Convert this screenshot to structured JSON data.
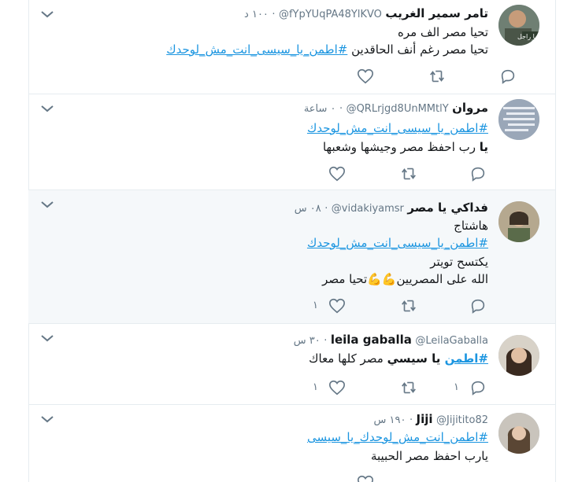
{
  "tweets": [
    {
      "name": "تامر سمير الغريب",
      "handle": "@fYpYUqPA48YlKVO",
      "time": "١٠٠ د",
      "lines": [
        {
          "text": "تحيا مصر الف مره"
        },
        {
          "text": "تحيا مصر رغم أنف الحاقدين ",
          "tag": "#اطمن_يا_سيسى_انت_مش_لوحدك"
        }
      ],
      "like_count": "",
      "avatar_text": "لا يا راجل"
    },
    {
      "name": "مروان",
      "handle": "@QRLrjgd8UnMMtlY",
      "time": "٠ ساعة",
      "lines": [
        {
          "tag": "#اطمن_يا_سيسى_انت_مش_لوحدك"
        },
        {
          "bold": "يا",
          "text": " رب احفظ مصر وجيشها وشعبها"
        }
      ],
      "like_count": ""
    },
    {
      "name": "فداكي يا مصر",
      "handle": "@vidakiyamsr",
      "time": "٠٨ س",
      "lines": [
        {
          "text": "هاشتاج"
        },
        {
          "tag": "#اطمن_يا_سيسى_انت_مش_لوحدك"
        },
        {
          "text": "يكتسح تويتر"
        },
        {
          "text": "الله على المصريين",
          "emoji": "💪💪",
          "text2": "تحيا مصر"
        }
      ],
      "like_count": "١"
    },
    {
      "name": "leila gaballa",
      "handle": "@LeilaGaballa",
      "time": "٣٠ س",
      "lines": [
        {
          "tag": "#اطمن",
          "bold": " يا سيسي",
          "text": " مصر كلها معاك"
        }
      ],
      "reply_count": "١",
      "like_count": "١"
    },
    {
      "name": "Jiji",
      "handle": "@Jijitito82",
      "time": "١٩٠ س",
      "lines": [
        {
          "tag": "#اطمن_انت_مش_لوحدك_يا_سيسى"
        },
        {
          "text": "يارب احفظ مصر الحبيبة"
        }
      ],
      "like_count": ""
    }
  ],
  "colors": {
    "link": "#1b95e0",
    "muted": "#657786",
    "border": "#e6ecf0",
    "highlight": "#f5f8fa"
  },
  "icons": [
    "chevron-down-icon",
    "reply-icon",
    "retweet-icon",
    "like-icon"
  ]
}
